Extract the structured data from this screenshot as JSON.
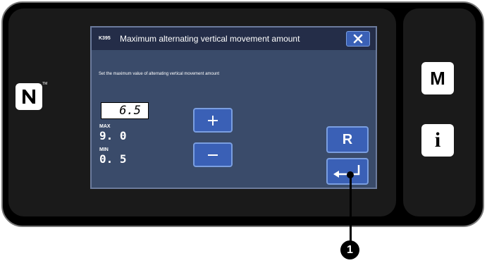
{
  "device": {
    "side_buttons": {
      "m_label": "M",
      "info_label": "i"
    }
  },
  "dialog": {
    "code": "K395",
    "title": "Maximum alternating vertical movement amount",
    "description": "Set the maximum value of alternating vertical movement amount",
    "value": "6.5",
    "max_label": "MAX",
    "max_value": "9. 0",
    "min_label": "MIN",
    "min_value": "0. 5",
    "reset_label": "R"
  },
  "callout": {
    "number": "1"
  },
  "colors": {
    "button_blue": "#3a60b6",
    "screen_bg": "#3a4b6a",
    "title_bar": "#242d48"
  }
}
